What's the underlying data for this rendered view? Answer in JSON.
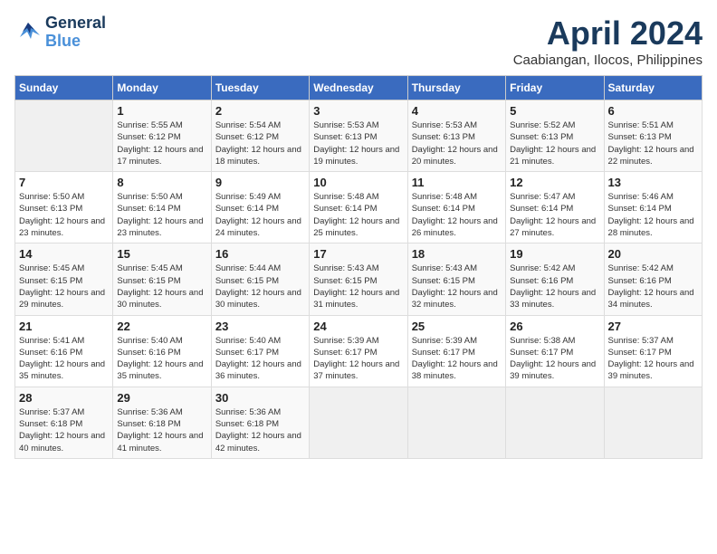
{
  "header": {
    "logo_line1": "General",
    "logo_line2": "Blue",
    "month": "April 2024",
    "location": "Caabiangan, Ilocos, Philippines"
  },
  "days_of_week": [
    "Sunday",
    "Monday",
    "Tuesday",
    "Wednesday",
    "Thursday",
    "Friday",
    "Saturday"
  ],
  "weeks": [
    [
      {
        "day": "",
        "sunrise": "",
        "sunset": "",
        "daylight": ""
      },
      {
        "day": "1",
        "sunrise": "Sunrise: 5:55 AM",
        "sunset": "Sunset: 6:12 PM",
        "daylight": "Daylight: 12 hours and 17 minutes."
      },
      {
        "day": "2",
        "sunrise": "Sunrise: 5:54 AM",
        "sunset": "Sunset: 6:12 PM",
        "daylight": "Daylight: 12 hours and 18 minutes."
      },
      {
        "day": "3",
        "sunrise": "Sunrise: 5:53 AM",
        "sunset": "Sunset: 6:13 PM",
        "daylight": "Daylight: 12 hours and 19 minutes."
      },
      {
        "day": "4",
        "sunrise": "Sunrise: 5:53 AM",
        "sunset": "Sunset: 6:13 PM",
        "daylight": "Daylight: 12 hours and 20 minutes."
      },
      {
        "day": "5",
        "sunrise": "Sunrise: 5:52 AM",
        "sunset": "Sunset: 6:13 PM",
        "daylight": "Daylight: 12 hours and 21 minutes."
      },
      {
        "day": "6",
        "sunrise": "Sunrise: 5:51 AM",
        "sunset": "Sunset: 6:13 PM",
        "daylight": "Daylight: 12 hours and 22 minutes."
      }
    ],
    [
      {
        "day": "7",
        "sunrise": "Sunrise: 5:50 AM",
        "sunset": "Sunset: 6:13 PM",
        "daylight": "Daylight: 12 hours and 23 minutes."
      },
      {
        "day": "8",
        "sunrise": "Sunrise: 5:50 AM",
        "sunset": "Sunset: 6:14 PM",
        "daylight": "Daylight: 12 hours and 23 minutes."
      },
      {
        "day": "9",
        "sunrise": "Sunrise: 5:49 AM",
        "sunset": "Sunset: 6:14 PM",
        "daylight": "Daylight: 12 hours and 24 minutes."
      },
      {
        "day": "10",
        "sunrise": "Sunrise: 5:48 AM",
        "sunset": "Sunset: 6:14 PM",
        "daylight": "Daylight: 12 hours and 25 minutes."
      },
      {
        "day": "11",
        "sunrise": "Sunrise: 5:48 AM",
        "sunset": "Sunset: 6:14 PM",
        "daylight": "Daylight: 12 hours and 26 minutes."
      },
      {
        "day": "12",
        "sunrise": "Sunrise: 5:47 AM",
        "sunset": "Sunset: 6:14 PM",
        "daylight": "Daylight: 12 hours and 27 minutes."
      },
      {
        "day": "13",
        "sunrise": "Sunrise: 5:46 AM",
        "sunset": "Sunset: 6:14 PM",
        "daylight": "Daylight: 12 hours and 28 minutes."
      }
    ],
    [
      {
        "day": "14",
        "sunrise": "Sunrise: 5:45 AM",
        "sunset": "Sunset: 6:15 PM",
        "daylight": "Daylight: 12 hours and 29 minutes."
      },
      {
        "day": "15",
        "sunrise": "Sunrise: 5:45 AM",
        "sunset": "Sunset: 6:15 PM",
        "daylight": "Daylight: 12 hours and 30 minutes."
      },
      {
        "day": "16",
        "sunrise": "Sunrise: 5:44 AM",
        "sunset": "Sunset: 6:15 PM",
        "daylight": "Daylight: 12 hours and 30 minutes."
      },
      {
        "day": "17",
        "sunrise": "Sunrise: 5:43 AM",
        "sunset": "Sunset: 6:15 PM",
        "daylight": "Daylight: 12 hours and 31 minutes."
      },
      {
        "day": "18",
        "sunrise": "Sunrise: 5:43 AM",
        "sunset": "Sunset: 6:15 PM",
        "daylight": "Daylight: 12 hours and 32 minutes."
      },
      {
        "day": "19",
        "sunrise": "Sunrise: 5:42 AM",
        "sunset": "Sunset: 6:16 PM",
        "daylight": "Daylight: 12 hours and 33 minutes."
      },
      {
        "day": "20",
        "sunrise": "Sunrise: 5:42 AM",
        "sunset": "Sunset: 6:16 PM",
        "daylight": "Daylight: 12 hours and 34 minutes."
      }
    ],
    [
      {
        "day": "21",
        "sunrise": "Sunrise: 5:41 AM",
        "sunset": "Sunset: 6:16 PM",
        "daylight": "Daylight: 12 hours and 35 minutes."
      },
      {
        "day": "22",
        "sunrise": "Sunrise: 5:40 AM",
        "sunset": "Sunset: 6:16 PM",
        "daylight": "Daylight: 12 hours and 35 minutes."
      },
      {
        "day": "23",
        "sunrise": "Sunrise: 5:40 AM",
        "sunset": "Sunset: 6:17 PM",
        "daylight": "Daylight: 12 hours and 36 minutes."
      },
      {
        "day": "24",
        "sunrise": "Sunrise: 5:39 AM",
        "sunset": "Sunset: 6:17 PM",
        "daylight": "Daylight: 12 hours and 37 minutes."
      },
      {
        "day": "25",
        "sunrise": "Sunrise: 5:39 AM",
        "sunset": "Sunset: 6:17 PM",
        "daylight": "Daylight: 12 hours and 38 minutes."
      },
      {
        "day": "26",
        "sunrise": "Sunrise: 5:38 AM",
        "sunset": "Sunset: 6:17 PM",
        "daylight": "Daylight: 12 hours and 39 minutes."
      },
      {
        "day": "27",
        "sunrise": "Sunrise: 5:37 AM",
        "sunset": "Sunset: 6:17 PM",
        "daylight": "Daylight: 12 hours and 39 minutes."
      }
    ],
    [
      {
        "day": "28",
        "sunrise": "Sunrise: 5:37 AM",
        "sunset": "Sunset: 6:18 PM",
        "daylight": "Daylight: 12 hours and 40 minutes."
      },
      {
        "day": "29",
        "sunrise": "Sunrise: 5:36 AM",
        "sunset": "Sunset: 6:18 PM",
        "daylight": "Daylight: 12 hours and 41 minutes."
      },
      {
        "day": "30",
        "sunrise": "Sunrise: 5:36 AM",
        "sunset": "Sunset: 6:18 PM",
        "daylight": "Daylight: 12 hours and 42 minutes."
      },
      {
        "day": "",
        "sunrise": "",
        "sunset": "",
        "daylight": ""
      },
      {
        "day": "",
        "sunrise": "",
        "sunset": "",
        "daylight": ""
      },
      {
        "day": "",
        "sunrise": "",
        "sunset": "",
        "daylight": ""
      },
      {
        "day": "",
        "sunrise": "",
        "sunset": "",
        "daylight": ""
      }
    ]
  ]
}
